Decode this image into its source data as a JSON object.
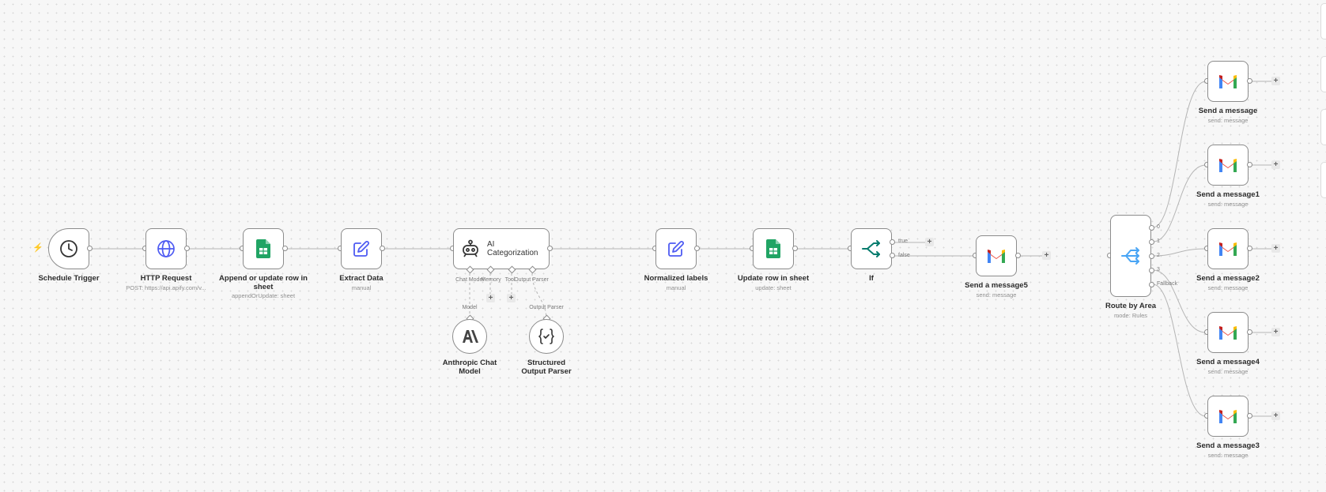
{
  "nodes": {
    "schedule_trigger": {
      "label": "Schedule Trigger"
    },
    "http_request": {
      "label": "HTTP Request",
      "sublabel": "POST: https://api.apify.com/v..."
    },
    "append_update": {
      "label": "Append or update row in sheet",
      "sublabel": "appendOrUpdate: sheet"
    },
    "extract_data": {
      "label": "Extract Data",
      "sublabel": "manual"
    },
    "ai_categorization": {
      "label": "AI Categorization",
      "ports": {
        "chat_model": "Chat Model",
        "memory": "Memory",
        "tool": "Tool",
        "output_parser": "Output Parser"
      }
    },
    "anthropic": {
      "label": "Anthropic Chat Model",
      "connection_label": "Model"
    },
    "structured_parser": {
      "label": "Structured Output Parser",
      "connection_label": "Output Parser"
    },
    "normalized_labels": {
      "label": "Normalized labels",
      "sublabel": "manual"
    },
    "update_row": {
      "label": "Update row in sheet",
      "sublabel": "update: sheet"
    },
    "if": {
      "label": "If",
      "outputs": {
        "true": "true",
        "false": "false"
      }
    },
    "send_message5": {
      "label": "Send a message5",
      "sublabel": "send: message"
    },
    "route_by_area": {
      "label": "Route by Area",
      "sublabel": "mode: Rules",
      "outputs": [
        "0",
        "1",
        "2",
        "3",
        "Fallback"
      ]
    },
    "send_message": {
      "label": "Send a message",
      "sublabel": "send: message"
    },
    "send_message1": {
      "label": "Send a message1",
      "sublabel": "send: message"
    },
    "send_message2": {
      "label": "Send a message2",
      "sublabel": "send: message"
    },
    "send_message4": {
      "label": "Send a message4",
      "sublabel": "send: message"
    },
    "send_message3": {
      "label": "Send a message3",
      "sublabel": "send: message"
    }
  },
  "ui": {
    "add_symbol": "+"
  },
  "icons": {
    "schedule_trigger": "clock-icon",
    "http_request": "globe-icon",
    "google_sheets": "google-sheets-icon",
    "edit": "pencil-edit-icon",
    "ai_agent": "robot-icon",
    "anthropic": "anthropic-icon",
    "parser": "braces-icon",
    "if": "branch-icon",
    "switch": "switch-icon",
    "gmail": "gmail-icon",
    "trigger_bolt": "lightning-bolt-icon"
  },
  "colors": {
    "edit_icon": "#4e5bf2",
    "http_icon": "#4e5bf2",
    "sheets_green": "#21a464",
    "if_teal": "#047b6d",
    "switch_blue": "#49a5f5",
    "bolt_orange": "#ff6d2e"
  }
}
